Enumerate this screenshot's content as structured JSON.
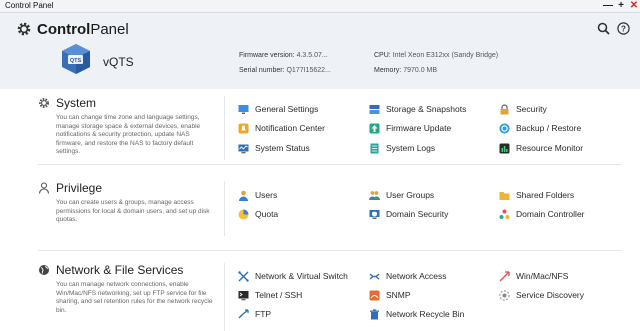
{
  "window": {
    "title": "Control Panel"
  },
  "header": {
    "title_a": "Control",
    "title_b": "Panel",
    "nas_name": "vQTS",
    "firmware_label": "Firmware version:",
    "firmware_value": "4.3.5.07...",
    "serial_label": "Serial number:",
    "serial_value": "Q177I15622...",
    "cpu_label": "CPU:",
    "cpu_value": "Intel Xeon E312xx (Sandy Bridge)",
    "memory_label": "Memory:",
    "memory_value": "7970.0 MB"
  },
  "sections": {
    "system": {
      "title": "System",
      "desc": "You can change time zone and language settings, manage storage space & external devices, enable notifications & security protection, update NAS firmware, and restore the NAS to factory default settings.",
      "items": [
        {
          "label": "General Settings",
          "icon": "monitor-settings-icon"
        },
        {
          "label": "Storage & Snapshots",
          "icon": "storage-icon"
        },
        {
          "label": "Security",
          "icon": "security-lock-icon"
        },
        {
          "label": "Notification Center",
          "icon": "notification-icon"
        },
        {
          "label": "Firmware Update",
          "icon": "firmware-update-icon"
        },
        {
          "label": "Backup / Restore",
          "icon": "backup-restore-icon"
        },
        {
          "label": "System Status",
          "icon": "system-status-icon"
        },
        {
          "label": "System Logs",
          "icon": "system-logs-icon"
        },
        {
          "label": "Resource Monitor",
          "icon": "resource-monitor-icon"
        }
      ]
    },
    "privilege": {
      "title": "Privilege",
      "desc": "You can create users & groups, manage access permissions for local & domain users, and set up disk quotas.",
      "items": [
        {
          "label": "Users",
          "icon": "user-icon"
        },
        {
          "label": "User Groups",
          "icon": "user-groups-icon"
        },
        {
          "label": "Shared Folders",
          "icon": "shared-folders-icon"
        },
        {
          "label": "Quota",
          "icon": "quota-icon"
        },
        {
          "label": "Domain Security",
          "icon": "domain-security-icon"
        },
        {
          "label": "Domain Controller",
          "icon": "domain-controller-icon"
        }
      ]
    },
    "network": {
      "title": "Network & File Services",
      "desc": "You can manage network connections, enable Win/Mac/NFS networking, set up FTP service for file sharing, and set retention rules for the network recycle bin.",
      "items": [
        {
          "label": "Network & Virtual Switch",
          "icon": "network-switch-icon"
        },
        {
          "label": "Network Access",
          "icon": "network-access-icon"
        },
        {
          "label": "Win/Mac/NFS",
          "icon": "win-mac-nfs-icon"
        },
        {
          "label": "Telnet / SSH",
          "icon": "telnet-ssh-icon"
        },
        {
          "label": "SNMP",
          "icon": "snmp-icon"
        },
        {
          "label": "Service Discovery",
          "icon": "service-discovery-icon"
        },
        {
          "label": "FTP",
          "icon": "ftp-icon"
        },
        {
          "label": "Network Recycle Bin",
          "icon": "network-recycle-bin-icon"
        }
      ]
    }
  },
  "colors": {
    "accent": "#2f7fd6",
    "header_bg": "#eef2f7"
  }
}
